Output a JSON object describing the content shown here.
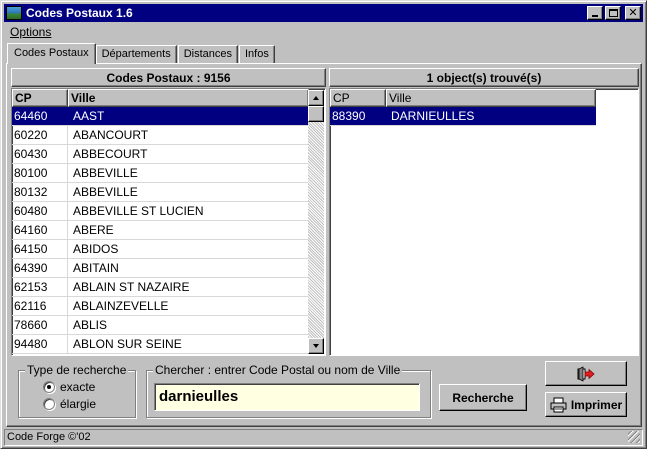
{
  "window": {
    "title": "Codes Postaux 1.6"
  },
  "menu": {
    "options_label": "Options"
  },
  "tabs": [
    {
      "label": "Codes Postaux",
      "active": true
    },
    {
      "label": "Départements",
      "active": false
    },
    {
      "label": "Distances",
      "active": false
    },
    {
      "label": "Infos",
      "active": false
    }
  ],
  "left_panel": {
    "header": "Codes Postaux : 9156",
    "columns": {
      "cp": "CP",
      "ville": "Ville"
    },
    "rows": [
      {
        "cp": "64460",
        "ville": "AAST",
        "selected": true
      },
      {
        "cp": "60220",
        "ville": "ABANCOURT"
      },
      {
        "cp": "60430",
        "ville": "ABBECOURT"
      },
      {
        "cp": "80100",
        "ville": "ABBEVILLE"
      },
      {
        "cp": "80132",
        "ville": "ABBEVILLE"
      },
      {
        "cp": "60480",
        "ville": "ABBEVILLE ST LUCIEN"
      },
      {
        "cp": "64160",
        "ville": "ABERE"
      },
      {
        "cp": "64150",
        "ville": "ABIDOS"
      },
      {
        "cp": "64390",
        "ville": "ABITAIN"
      },
      {
        "cp": "62153",
        "ville": "ABLAIN ST NAZAIRE"
      },
      {
        "cp": "62116",
        "ville": "ABLAINZEVELLE"
      },
      {
        "cp": "78660",
        "ville": "ABLIS"
      },
      {
        "cp": "94480",
        "ville": "ABLON SUR SEINE"
      }
    ]
  },
  "right_panel": {
    "header": "1 object(s) trouvé(s)",
    "columns": {
      "cp": "CP",
      "ville": "Ville"
    },
    "rows": [
      {
        "cp": "88390",
        "ville": "DARNIEULLES",
        "selected": true
      }
    ]
  },
  "search_type": {
    "label": "Type de recherche",
    "options": [
      {
        "label": "exacte",
        "checked": true
      },
      {
        "label": "élargie",
        "checked": false
      }
    ]
  },
  "search": {
    "label": "Chercher : entrer Code Postal ou nom de Ville",
    "value": "darnieulles"
  },
  "buttons": {
    "search_label": "Recherche",
    "print_label": "Imprimer",
    "exit_icon": "exit-arrow-icon",
    "print_icon": "printer-icon"
  },
  "statusbar": {
    "text": "Code Forge ©'02"
  }
}
